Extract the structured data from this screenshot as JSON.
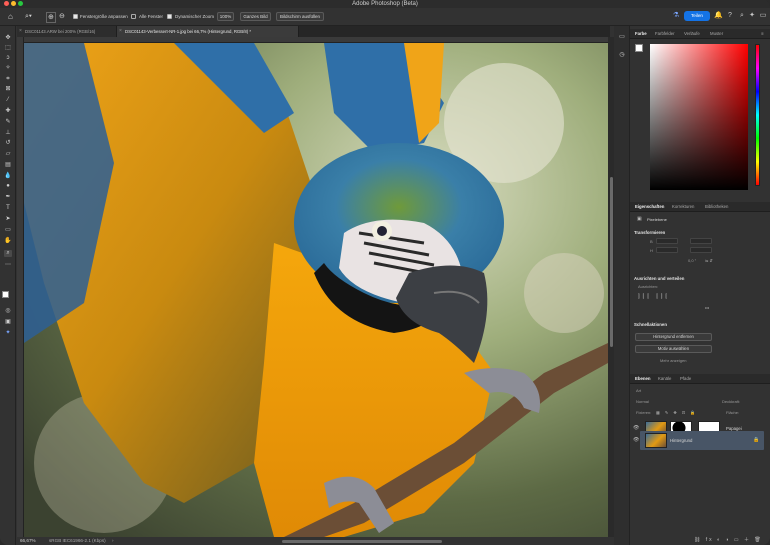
{
  "window": {
    "title": "Adobe Photoshop (Beta)"
  },
  "options_bar": {
    "resize_windows_label": "Fensterg­röße anpassen",
    "all_windows_label": "Alle Fenster",
    "scrubby_zoom_label": "Dynamischer Zoom",
    "zoom_100_label": "100%",
    "fit_screen_label": "Ganzes Bild",
    "fill_screen_label": "Bildschirm ausfüllen",
    "share_label": "Teilen"
  },
  "tabs": [
    {
      "label": "DSC01143.ARW bei 200% (RGB/16)",
      "active": false
    },
    {
      "label": "DSC01143-Verbessert-NR-1.jpg bei 66,7% (Hintergrund, RGB/8) *",
      "active": true
    }
  ],
  "status_bar": {
    "zoom": "66,67%",
    "profile": "sRGB IEC61966-2.1 (Kbps)"
  },
  "color_panel": {
    "tabs": [
      "Farbe",
      "Farbfelder",
      "Verläufe",
      "Muster"
    ],
    "active_tab": "Farbe",
    "foreground": "#ffffff",
    "hue_color": "#ff0000"
  },
  "properties_panel": {
    "tabs": [
      "Eigenschaften",
      "Korrekturen",
      "Bibliotheken"
    ],
    "active_tab": "Eigenschaften",
    "layer_type": "Pixelebene",
    "transform_title": "Transformieren",
    "align_title": "Ausrichten und verteilen",
    "align_sub": "Ausrichten:",
    "quick_actions_title": "Schnellaktionen",
    "quick_actions": [
      "Hintergrund entfernen",
      "Motiv auswählen"
    ],
    "more": "Mehr anzeigen",
    "angle_value": "0,0 °"
  },
  "layers_panel": {
    "tabs": [
      "Ebenen",
      "Kanäle",
      "Pfade"
    ],
    "active_tab": "Ebenen",
    "kind_filter": "Art",
    "blend_mode": "Normal",
    "opacity_label": "Deckkraft:",
    "lock_label": "Fixieren:",
    "fill_label": "Fläche:",
    "layers": [
      {
        "name": "Papagei-mask",
        "display": "Papagei",
        "selected": false
      },
      {
        "name": "Hintergrund",
        "display": "Hintergrund",
        "selected": true
      }
    ]
  }
}
